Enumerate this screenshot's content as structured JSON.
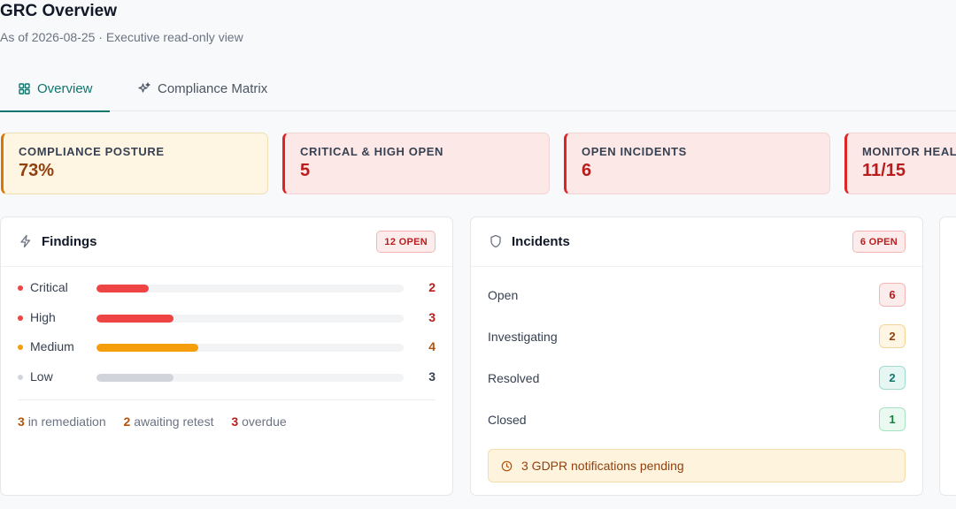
{
  "header": {
    "title": "GRC Overview",
    "subtitle": "As of 2026-08-25 · Executive read-only view"
  },
  "tabs": [
    {
      "label": "Overview",
      "icon": "grid-icon",
      "active": true
    },
    {
      "label": "Compliance Matrix",
      "icon": "sparkle-icon",
      "active": false
    }
  ],
  "kpis": [
    {
      "label": "COMPLIANCE POSTURE",
      "value": "73%"
    },
    {
      "label": "CRITICAL & HIGH OPEN",
      "value": "5"
    },
    {
      "label": "OPEN INCIDENTS",
      "value": "6"
    },
    {
      "label": "MONITOR HEALTH",
      "value": "11/15"
    }
  ],
  "findings": {
    "title": "Findings",
    "badge": "12 OPEN",
    "icon": "bolt-icon",
    "rows": [
      {
        "label": "Critical",
        "count": "2",
        "fraction": 0.17,
        "color": "#ef4444",
        "count_color": "#b91c1c"
      },
      {
        "label": "High",
        "count": "3",
        "fraction": 0.25,
        "color": "#ef4444",
        "count_color": "#b91c1c"
      },
      {
        "label": "Medium",
        "count": "4",
        "fraction": 0.33,
        "color": "#f59e0b",
        "count_color": "#b45309"
      },
      {
        "label": "Low",
        "count": "3",
        "fraction": 0.25,
        "color": "#d1d5db",
        "count_color": "#374151"
      }
    ],
    "footer": {
      "remediation_count": "3",
      "remediation_label": "in remediation",
      "retest_count": "2",
      "retest_label": "awaiting retest",
      "overdue_count": "3",
      "overdue_label": "overdue"
    }
  },
  "incidents": {
    "title": "Incidents",
    "badge": "6 OPEN",
    "icon": "shield-icon",
    "rows": [
      {
        "label": "Open",
        "count": "6",
        "bg": "#fdecec",
        "border": "#f5b5b5",
        "color": "#b91c1c"
      },
      {
        "label": "Investigating",
        "count": "2",
        "bg": "#fef5e2",
        "border": "#f3d59a",
        "color": "#92400e"
      },
      {
        "label": "Resolved",
        "count": "2",
        "bg": "#e6f7f3",
        "border": "#9fdcce",
        "color": "#0f766e"
      },
      {
        "label": "Closed",
        "count": "1",
        "bg": "#eafaf1",
        "border": "#a7e3c2",
        "color": "#15803d"
      }
    ],
    "note": "3 GDPR notifications pending"
  }
}
